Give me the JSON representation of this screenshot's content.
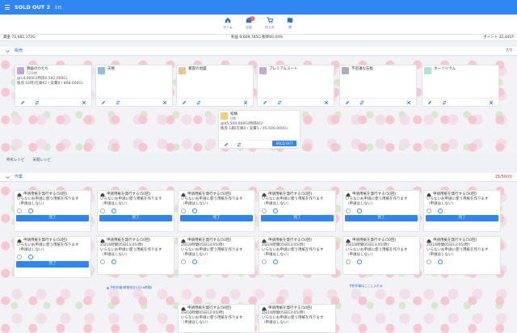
{
  "app": {
    "title": "SOLD OUT 2",
    "day": "5日"
  },
  "nav": [
    {
      "label": "ホーム"
    },
    {
      "label": "お店",
      "badge": "5"
    },
    {
      "label": "仕入れ"
    },
    {
      "label": "港"
    }
  ],
  "status": {
    "left": "資金 72,681,172G",
    "mid": "利益 9,609,785G 税率60.04%",
    "right": "ポイント 32,441P"
  },
  "sale": {
    "title": "販売",
    "count": "7/7",
    "items": [
      {
        "name": "錦画のかたち",
        "stock": "520枚",
        "l1": "@14,000G(時価1,592,000G)",
        "l2": "販売 62時(在庫62 / 実費0 / 868,000G)"
      },
      {
        "name": "天極"
      },
      {
        "name": "暴雲の地図"
      },
      {
        "name": "プレミアムミート"
      },
      {
        "name": "不思議な石板"
      },
      {
        "name": "ホーリリウム"
      }
    ],
    "extra": {
      "name": "棺桶",
      "stock": "0枚",
      "l1": "@45,500,000G(時価0G)",
      "l2": "販売 1箱(在庫0 / 実費1 / 45,500,000G)",
      "button": "SOLD OUT"
    }
  },
  "links": {
    "all": "所有レシピ",
    "new": "未開レシピ"
  },
  "work": {
    "title": "作業",
    "count": "15/50(0)"
  },
  "tasks": {
    "title": "申請用紙を発行する(50回)",
    "desc1": "いらないお申請に使う用紙を作ります",
    "desc2": "（申請はしない）",
    "done": "完了",
    "date": "2日16時間05日13:05(時)"
  },
  "notes": {
    "n1": "▲ 予約作業(時間合計2日16時間)",
    "n2": "予約作業はここに入れる"
  }
}
